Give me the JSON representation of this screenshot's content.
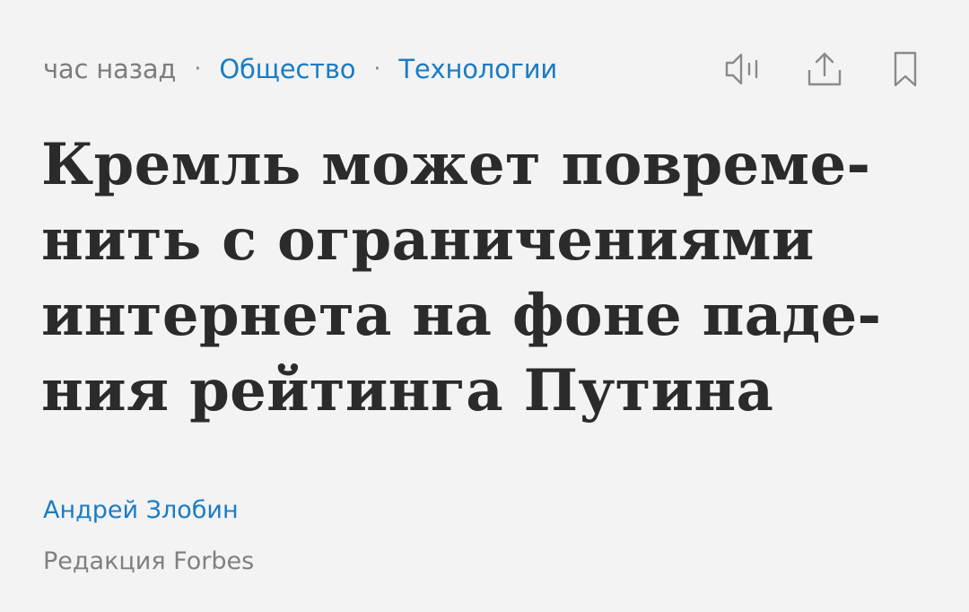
{
  "meta": {
    "time": "час назад",
    "separator": "·",
    "categories": [
      "Общество",
      "Технологии"
    ]
  },
  "actions": {
    "listen_icon": "speaker-icon",
    "share_icon": "share-icon",
    "bookmark_icon": "bookmark-icon"
  },
  "headline": {
    "lines": [
      "Кремль может повреме-",
      "нить с ограничениями",
      "интернета на фоне паде-",
      "ния рейтинга Путина"
    ]
  },
  "author": {
    "name": "Андрей Злобин",
    "affiliation": "Редакция Forbes"
  },
  "colors": {
    "background": "#f3f3f3",
    "link": "#1a7cc4",
    "headline": "#2b2b2b",
    "muted": "#7d7d7d",
    "icon": "#8a8a8a"
  }
}
